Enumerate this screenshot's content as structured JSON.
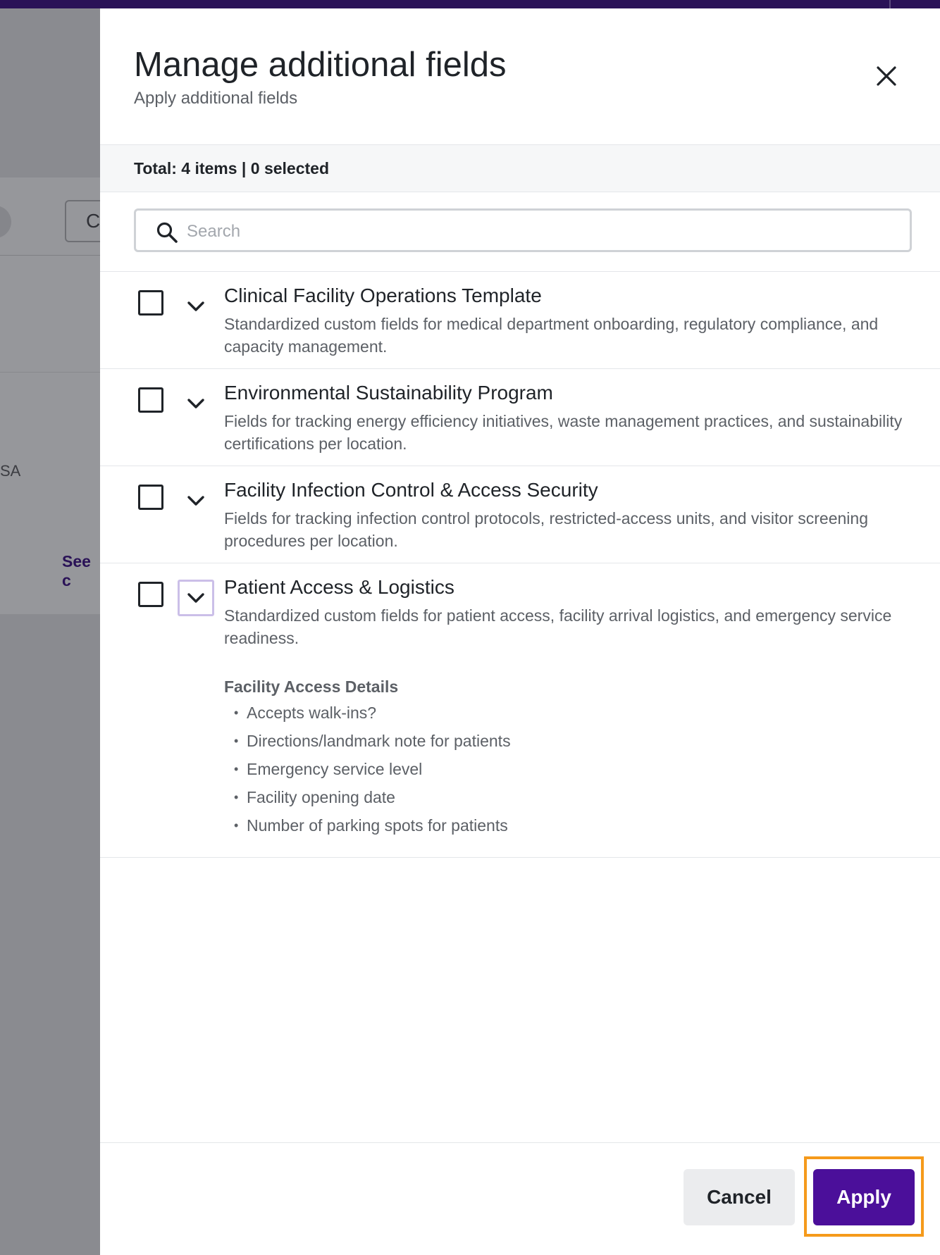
{
  "background": {
    "button_letter": "C",
    "country_fragment": "SA",
    "link_fragment": "See c"
  },
  "drawer": {
    "title": "Manage additional fields",
    "subtitle": "Apply additional fields",
    "close_icon": "close-icon",
    "total_text": "Total: 4 items | 0 selected",
    "search": {
      "placeholder": "Search",
      "value": "",
      "icon": "search-icon"
    },
    "items": [
      {
        "title": "Clinical Facility Operations Template",
        "description": "Standardized custom fields for medical department onboarding, regulatory compliance, and capacity management.",
        "checked": false,
        "expanded": false
      },
      {
        "title": "Environmental Sustainability Program",
        "description": "Fields for tracking energy efficiency initiatives, waste management practices, and sustainability certifications per location.",
        "checked": false,
        "expanded": false
      },
      {
        "title": "Facility Infection Control & Access Security",
        "description": "Fields for tracking infection control protocols, restricted-access units, and visitor screening procedures per location.",
        "checked": false,
        "expanded": false
      },
      {
        "title": "Patient Access & Logistics",
        "description": "Standardized custom fields for patient access, facility arrival logistics, and emergency service readiness.",
        "checked": false,
        "expanded": true,
        "group_title": "Facility Access Details",
        "fields": [
          "Accepts walk-ins?",
          "Directions/landmark note for patients",
          "Emergency service level",
          "Facility opening date",
          "Number of parking spots for patients"
        ]
      }
    ],
    "footer": {
      "cancel_label": "Cancel",
      "apply_label": "Apply"
    }
  },
  "colors": {
    "brand_dark": "#2a1257",
    "primary_button": "#4b0f9a",
    "highlight": "#f59a1b",
    "focus_ring": "#cbbfe8"
  }
}
